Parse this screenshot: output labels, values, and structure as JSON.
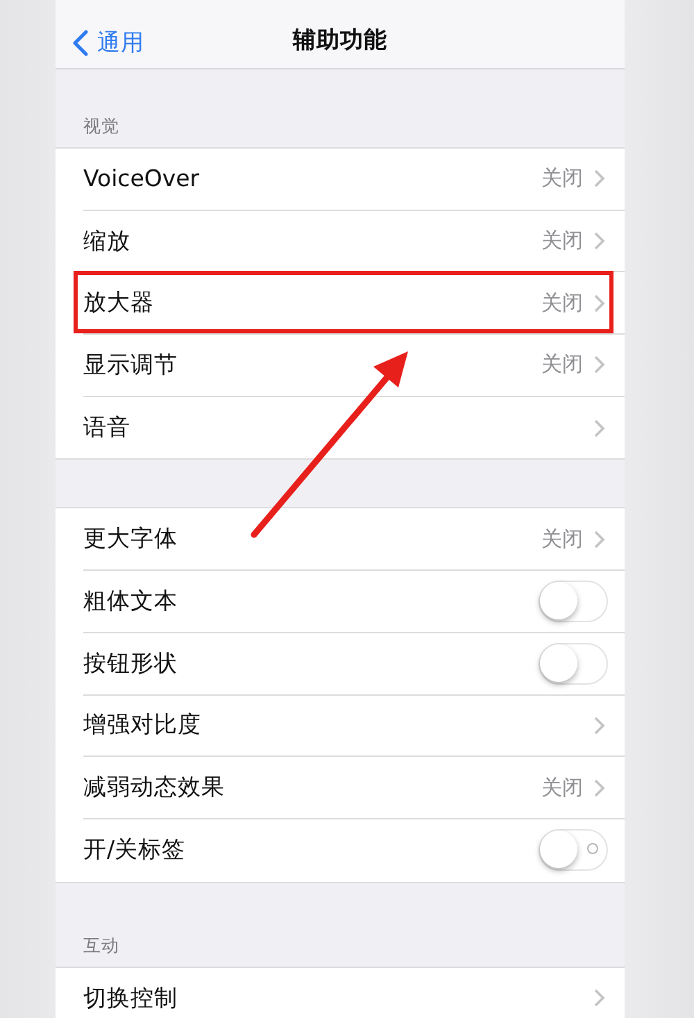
{
  "nav": {
    "back": "通用",
    "title": "辅助功能"
  },
  "sections": [
    {
      "header": "视觉",
      "rows": [
        {
          "kind": "detail",
          "label": "VoiceOver",
          "value": "关闭",
          "highlighted": false
        },
        {
          "kind": "detail",
          "label": "缩放",
          "value": "关闭",
          "highlighted": false
        },
        {
          "kind": "detail",
          "label": "放大器",
          "value": "关闭",
          "highlighted": true
        },
        {
          "kind": "detail",
          "label": "显示调节",
          "value": "关闭",
          "highlighted": false
        },
        {
          "kind": "detail",
          "label": "语音",
          "highlighted": false
        }
      ]
    },
    {
      "rows": [
        {
          "kind": "detail",
          "label": "更大字体",
          "value": "关闭",
          "highlighted": false
        },
        {
          "kind": "toggle",
          "label": "粗体文本",
          "on": false,
          "show_labels": false,
          "highlighted": false
        },
        {
          "kind": "toggle",
          "label": "按钮形状",
          "on": false,
          "show_labels": false,
          "highlighted": false
        },
        {
          "kind": "detail",
          "label": "增强对比度",
          "highlighted": false
        },
        {
          "kind": "detail",
          "label": "减弱动态效果",
          "value": "关闭",
          "highlighted": false
        },
        {
          "kind": "toggle",
          "label": "开/关标签",
          "on": false,
          "show_labels": true,
          "highlighted": false
        }
      ]
    },
    {
      "header": "互动",
      "rows": [
        {
          "kind": "detail",
          "label": "切换控制",
          "highlighted": false
        }
      ]
    }
  ],
  "annotations": {
    "arrow": true
  }
}
